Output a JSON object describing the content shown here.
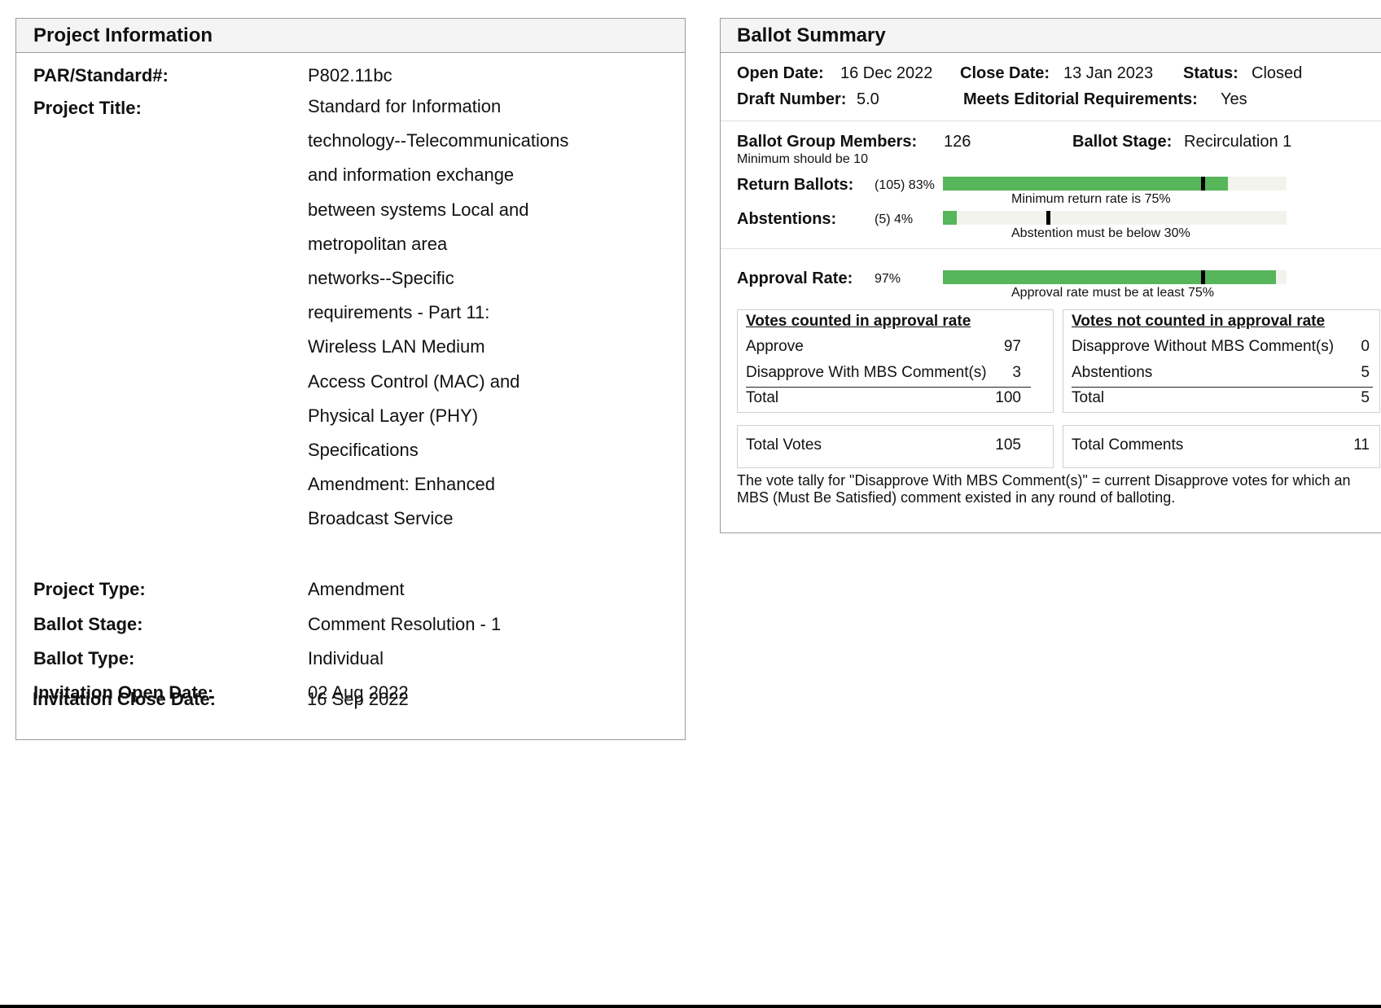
{
  "project": {
    "header": "Project Information",
    "fields": {
      "par_label": "PAR/Standard#:",
      "par_value": "P802.11bc",
      "title_label": "Project Title:",
      "title_lines": [
        "Standard for Information",
        "technology--Telecommunications",
        "and information exchange",
        "between systems Local and",
        "metropolitan area",
        "networks--Specific",
        "requirements - Part 11:",
        "Wireless LAN Medium",
        "Access Control (MAC) and",
        "Physical Layer (PHY)",
        "Specifications",
        "Amendment: Enhanced",
        "Broadcast Service"
      ],
      "type_label": "Project Type:",
      "type_value": "Amendment",
      "stage_label": "Ballot Stage:",
      "stage_value": "Comment Resolution - 1",
      "btype_label": "Ballot Type:",
      "btype_value": "Individual",
      "open_label": "Invitation Open Date:",
      "open_value": "02 Aug 2022",
      "close_label": "Invitation Close Date:",
      "close_value": "16 Sep 2022"
    }
  },
  "ballot": {
    "header": "Ballot Summary",
    "open_date_label": "Open Date:",
    "open_date": "16 Dec 2022",
    "close_date_label": "Close Date:",
    "close_date": "13 Jan 2023",
    "status_label": "Status:",
    "status": "Closed",
    "draft_label": "Draft Number:",
    "draft": "5.0",
    "editorial_label": "Meets Editorial Requirements:",
    "editorial": "Yes",
    "members_label": "Ballot Group Members:",
    "members": "126",
    "members_note": "Minimum should be 10",
    "stage_label": "Ballot Stage:",
    "stage": "Recirculation 1",
    "return_label": "Return Ballots:",
    "return_value": "(105) 83%",
    "return_fraction": 0.83,
    "return_threshold": 0.75,
    "return_note": "Minimum return rate is 75%",
    "abst_label": "Abstentions:",
    "abst_value": "(5) 4%",
    "abst_fraction": 0.04,
    "abst_threshold": 0.3,
    "abst_note": "Abstention must be below 30%",
    "approval_label": "Approval Rate:",
    "approval_value": "97%",
    "approval_fraction": 0.97,
    "approval_threshold": 0.75,
    "approval_note": "Approval rate must be at least 75%",
    "counted": {
      "header": "Votes counted in approval rate",
      "approve_label": "Approve",
      "approve": "97",
      "disapprove_label": "Disapprove With MBS Comment(s)",
      "disapprove": "3",
      "total_label": "Total",
      "total": "100"
    },
    "not_counted": {
      "header": "Votes not counted in approval rate",
      "disapprove_label": "Disapprove Without MBS Comment(s)",
      "disapprove": "0",
      "abst_label": "Abstentions",
      "abst": "5",
      "total_label": "Total",
      "total": "5"
    },
    "total_votes_label": "Total Votes",
    "total_votes": "105",
    "total_comments_label": "Total Comments",
    "total_comments": "11",
    "footnote": "The vote tally for \"Disapprove With MBS Comment(s)\" = current Disapprove votes for which an MBS (Must Be Satisfied) comment existed in any round of balloting.",
    "bar_color": "#57b55a"
  }
}
